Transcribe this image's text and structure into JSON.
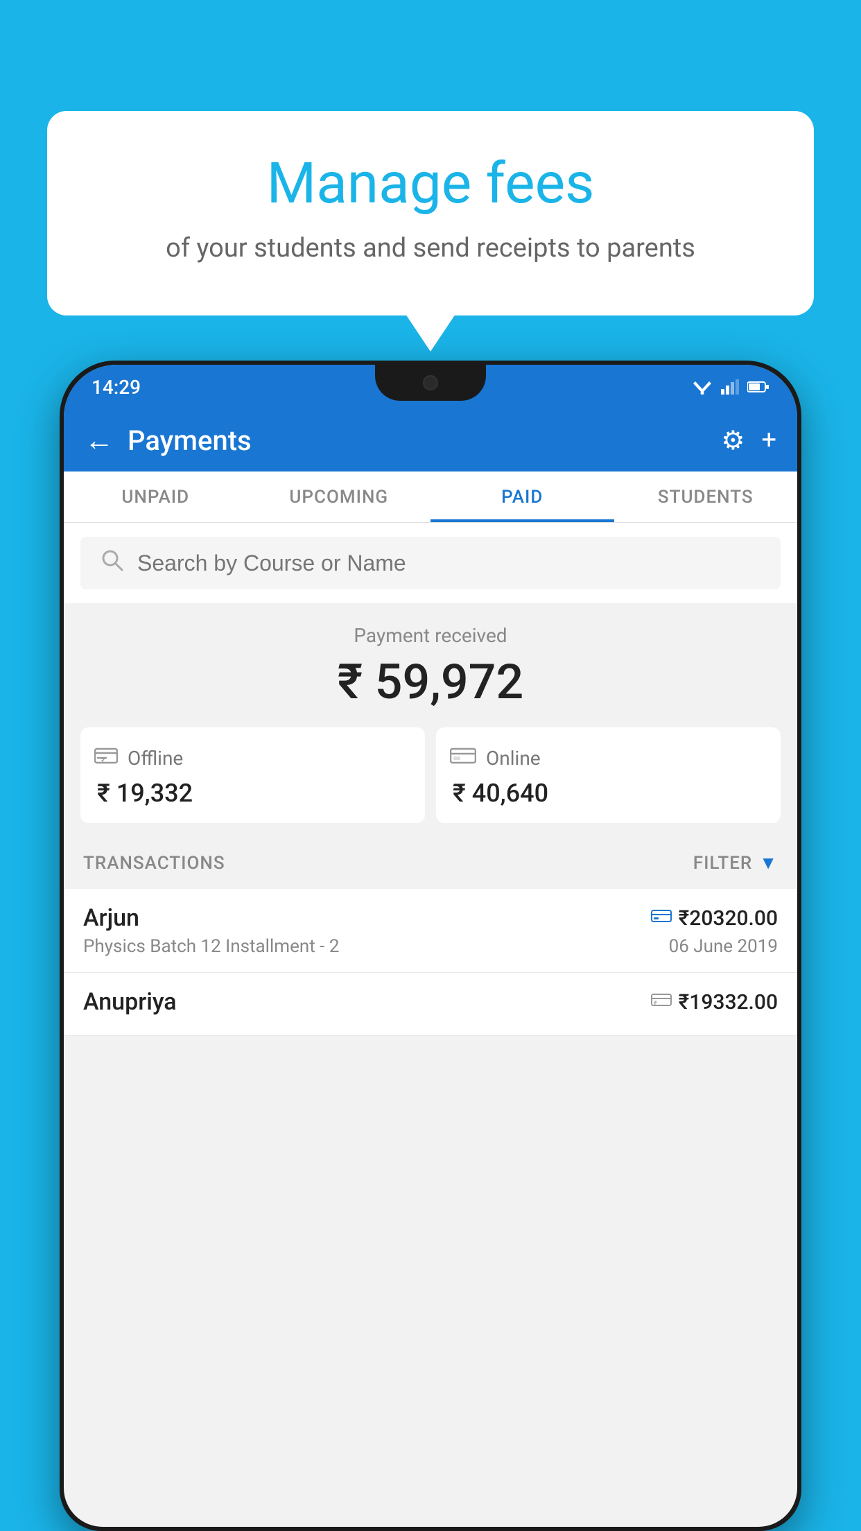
{
  "page": {
    "bg_color": "#1ab4e8"
  },
  "bubble": {
    "title": "Manage fees",
    "subtitle": "of your students and send receipts to parents"
  },
  "status_bar": {
    "time": "14:29"
  },
  "header": {
    "title": "Payments",
    "back_label": "←",
    "settings_label": "⚙",
    "add_label": "+"
  },
  "tabs": [
    {
      "label": "UNPAID",
      "active": false
    },
    {
      "label": "UPCOMING",
      "active": false
    },
    {
      "label": "PAID",
      "active": true
    },
    {
      "label": "STUDENTS",
      "active": false
    }
  ],
  "search": {
    "placeholder": "Search by Course or Name"
  },
  "payment_summary": {
    "received_label": "Payment received",
    "total_amount": "₹ 59,972",
    "offline": {
      "type": "Offline",
      "amount": "₹ 19,332"
    },
    "online": {
      "type": "Online",
      "amount": "₹ 40,640"
    }
  },
  "transactions": {
    "section_label": "TRANSACTIONS",
    "filter_label": "FILTER",
    "items": [
      {
        "name": "Arjun",
        "mode_icon": "💳",
        "amount": "₹20320.00",
        "detail": "Physics Batch 12 Installment - 2",
        "date": "06 June 2019"
      },
      {
        "name": "Anupriya",
        "mode_icon": "🏦",
        "amount": "₹19332.00",
        "detail": "",
        "date": ""
      }
    ]
  }
}
